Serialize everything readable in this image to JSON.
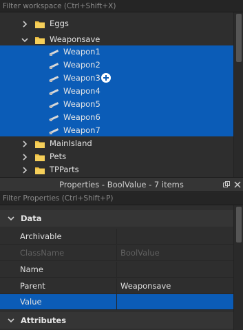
{
  "explorer": {
    "filter_placeholder": "Filter workspace (Ctrl+Shift+X)",
    "items": [
      {
        "label": "Eggs",
        "icon": "folder-icon",
        "expanded": false
      },
      {
        "label": "Weaponsave",
        "icon": "folder-icon",
        "expanded": true
      },
      {
        "label": "Weapon1",
        "icon": "bool-value-icon",
        "selected": true
      },
      {
        "label": "Weapon2",
        "icon": "bool-value-icon",
        "selected": true
      },
      {
        "label": "Weapon3",
        "icon": "bool-value-icon",
        "selected": true
      },
      {
        "label": "Weapon4",
        "icon": "bool-value-icon",
        "selected": true
      },
      {
        "label": "Weapon5",
        "icon": "bool-value-icon",
        "selected": true
      },
      {
        "label": "Weapon6",
        "icon": "bool-value-icon",
        "selected": true
      },
      {
        "label": "Weapon7",
        "icon": "bool-value-icon",
        "selected": true
      },
      {
        "label": "MainIsland",
        "icon": "folder-icon",
        "expanded": false
      },
      {
        "label": "Pets",
        "icon": "folder-icon",
        "expanded": false
      },
      {
        "label": "TPParts",
        "icon": "folder-icon",
        "expanded": false
      }
    ]
  },
  "properties": {
    "title": "Properties - BoolValue - 7 items",
    "filter_placeholder": "Filter Properties (Ctrl+Shift+P)",
    "sections": {
      "data": "Data",
      "attributes": "Attributes"
    },
    "rows": {
      "archivable": {
        "name": "Archivable",
        "checked": true
      },
      "classname": {
        "name": "ClassName",
        "value": "BoolValue"
      },
      "name": {
        "name": "Name",
        "value": ""
      },
      "parent": {
        "name": "Parent",
        "value": "Weaponsave"
      },
      "value": {
        "name": "Value",
        "checked": true
      }
    }
  },
  "colors": {
    "selection": "#0b5cb7",
    "panel_bg": "#2e2e2e",
    "folder": "#f0c040"
  }
}
